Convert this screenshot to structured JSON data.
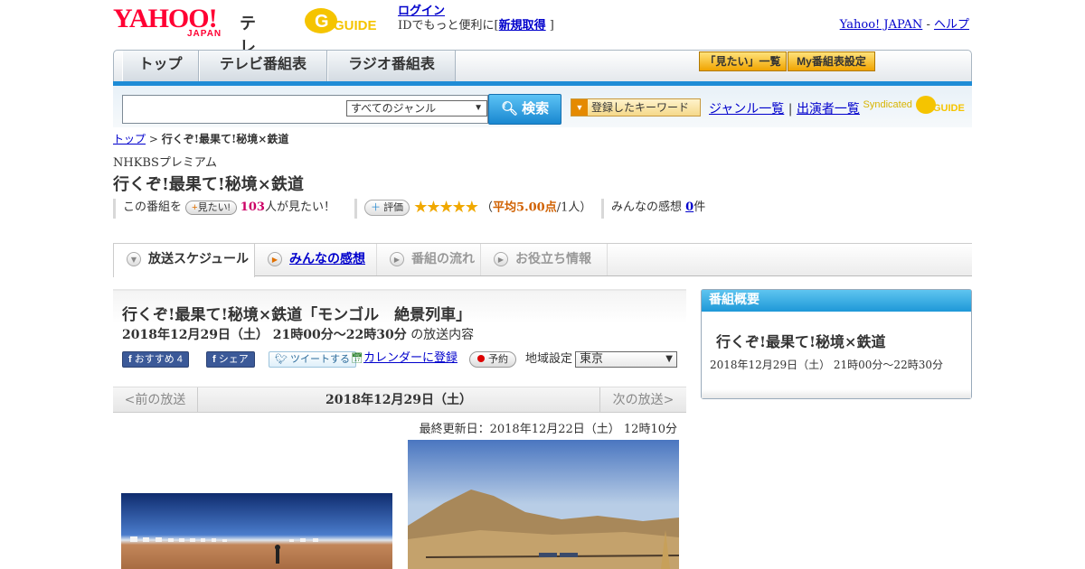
{
  "header": {
    "yahoo_logo": "YAHOO!",
    "japan_text": "JAPAN",
    "tv_label": "テレビ",
    "gguide_logo": "GUIDE",
    "login_link": "ログイン",
    "login_sub": "IDでもっと便利に[",
    "register_link": "新規取得",
    "login_sub_end": "]",
    "yahoo_japan_link": "Yahoo! JAPAN",
    "separator": "-",
    "help_link": "ヘルプ"
  },
  "nav": {
    "tabs": [
      {
        "label": "トップ"
      },
      {
        "label": "テレビ番組表"
      },
      {
        "label": "ラジオ番組表"
      }
    ],
    "mitai_list_btn": "「見たい」一覧",
    "my_schedule_btn": "My番組表設定"
  },
  "search": {
    "placeholder": "",
    "genre_selected": "すべてのジャンル",
    "search_btn": "検索",
    "keyword_btn": "登録したキーワード",
    "genre_list_link": "ジャンル一覧",
    "sep": "|",
    "performer_link": "出演者一覧",
    "syndicated": "Syndicated"
  },
  "breadcrumb": {
    "top": "トップ",
    "sep": ">",
    "current": "行くぞ!最果て!秘境×鉄道"
  },
  "program": {
    "channel": "NHKBSプレミアム",
    "title": "行くぞ!最果て!秘境×鉄道",
    "this_program": "この番組を",
    "mitai_btn": "見たい!",
    "mitai_count": "103",
    "mitai_suffix": "人が見たい！",
    "hyoka_btn": "評価",
    "stars": "★★★★★",
    "rating_open": "（",
    "rating_avg": "平均5.00点",
    "rating_people": "/1人）",
    "rating_value": 5.0,
    "impressions_label": "みんなの感想",
    "impressions_count": "0",
    "impressions_suffix": "件"
  },
  "tabs": [
    {
      "label": "放送スケジュール"
    },
    {
      "label": "みんなの感想"
    },
    {
      "label": "番組の流れ"
    },
    {
      "label": "お役立ち情報"
    }
  ],
  "episode": {
    "title": "行くぞ!最果て!秘境×鉄道「モンゴル　絶景列車」",
    "datetime": "2018年12月29日（土）  21時00分～22時30分",
    "datetime_suffix": "の放送内容",
    "recommend_btn": "おすすめ",
    "recommend_count": "4",
    "share_btn": "シェア",
    "tweet_btn": "ツイートする",
    "calendar_link": "カレンダーに登録",
    "reserve_btn": "予約",
    "region_label": "地域設定",
    "region_selected": "東京"
  },
  "pager": {
    "prev": "<前の放送",
    "date": "2018年12月29日（土）",
    "next": "次の放送>"
  },
  "updated": "最終更新日：2018年12月22日（土）  12時10分",
  "side": {
    "heading": "番組概要",
    "title": "行くぞ!最果て!秘境×鉄道",
    "time": "2018年12月29日（土）  21時00分～22時30分"
  }
}
